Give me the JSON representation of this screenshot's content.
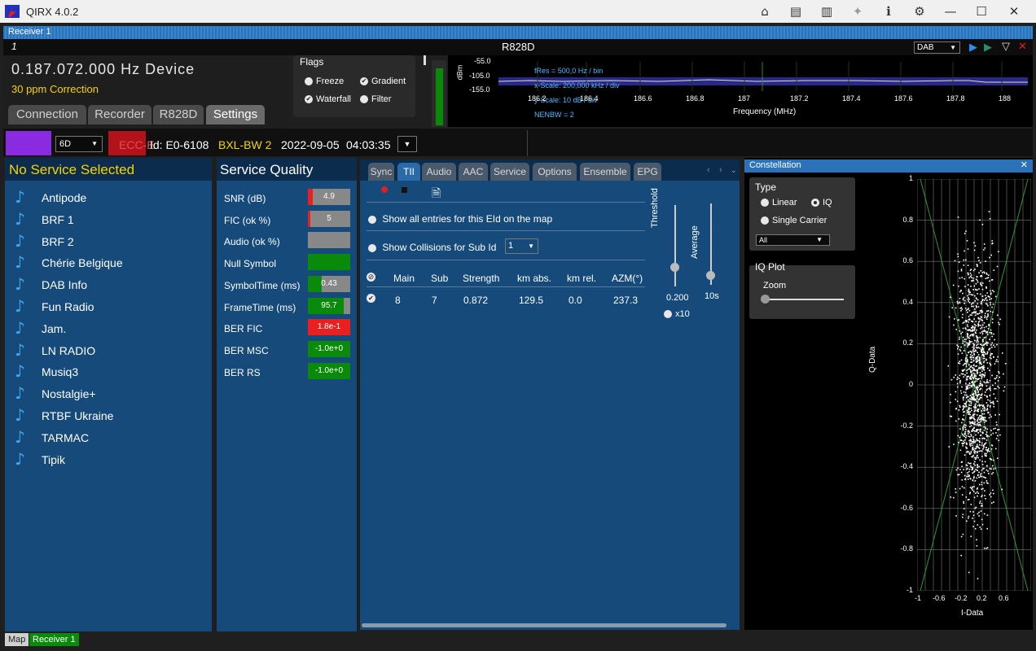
{
  "window": {
    "title": "QIRX 4.0.2"
  },
  "receiver": {
    "strip_title": "Receiver 1",
    "index": "1",
    "tuner": "R828D",
    "mode": "DAB"
  },
  "frequency": {
    "value": "0.187.072.000 Hz Device",
    "correction": "30 ppm Correction"
  },
  "tabs": [
    "Connection",
    "Recorder",
    "R828D",
    "Settings"
  ],
  "flags": {
    "title": "Flags",
    "freeze": "Freeze",
    "gradient": "Gradient",
    "waterfall": "Waterfall",
    "filter": "Filter"
  },
  "spectrum": {
    "y_unit": "dBm",
    "y_ticks": [
      "-55.0",
      "-105.0",
      "-155.0"
    ],
    "x_ticks": [
      "186.2",
      "186.4",
      "186.6",
      "186.8",
      "187",
      "187.2",
      "187.4",
      "187.6",
      "187.8",
      "188"
    ],
    "x_label": "Frequency (MHz)",
    "fres": "fRes = 500,0 Hz / bin",
    "xscale": "x-Scale: 200,000 kHz / div",
    "yscale": "y-Scale: 10 dB / div",
    "nenbw": "NENBW = 2"
  },
  "info": {
    "channel": "6D",
    "ecc_label": "ECC-E",
    "eid": "Id: E0-6108",
    "ensemble": "BXL-BW 2",
    "date": "2022-09-05",
    "time": "04:03:35"
  },
  "services": {
    "header": "No Service Selected",
    "items": [
      "Antipode",
      "BRF 1",
      "BRF 2",
      "Chérie Belgique",
      "DAB Info",
      "Fun Radio",
      "Jam.",
      "LN RADIO",
      "Musiq3",
      "Nostalgie+",
      "RTBF Ukraine",
      "TARMAC",
      "Tipik"
    ]
  },
  "quality": {
    "header": "Service Quality",
    "rows": [
      {
        "label": "SNR (dB)",
        "value": "4.9",
        "level": 0.12,
        "color": "#e82020"
      },
      {
        "label": "FIC (ok %)",
        "value": "5",
        "level": 0.05,
        "color": "#e82020"
      },
      {
        "label": "Audio (ok %)",
        "value": "",
        "level": 0,
        "color": "#e82020"
      },
      {
        "label": "Null Symbol",
        "value": "",
        "level": 1.0,
        "color": "#0a8a0a"
      },
      {
        "label": "SymbolTime (ms)",
        "value": "0.43",
        "level": 0.33,
        "color": "#0a8a0a"
      },
      {
        "label": "FrameTime (ms)",
        "value": "95.7",
        "level": 0.85,
        "color": "#0a8a0a"
      },
      {
        "label": "BER FIC",
        "value": "1.8e-1",
        "level": 1.0,
        "color": "#e82020"
      },
      {
        "label": "BER MSC",
        "value": "-1.0e+0",
        "level": 1.0,
        "color": "#0a8a0a"
      },
      {
        "label": "BER RS",
        "value": "-1.0e+0",
        "level": 1.0,
        "color": "#0a8a0a"
      }
    ]
  },
  "midtabs": [
    "Sync",
    "TII",
    "Audio",
    "AAC",
    "Service",
    "Options",
    "Ensemble",
    "EPG"
  ],
  "tii": {
    "show_all": "Show all entries for this EId on the map",
    "show_collisions": "Show Collisions for Sub Id",
    "sub_id": "1",
    "columns": [
      "Main",
      "Sub",
      "Strength",
      "km abs.",
      "km rel.",
      "AZM(°)"
    ],
    "rows": [
      [
        "8",
        "7",
        "0.872",
        "129.5",
        "0.0",
        "237.3"
      ]
    ],
    "threshold_label": "Threshold",
    "threshold_value": "0.200",
    "x10": "x10",
    "average_label": "Average",
    "average_value": "10s"
  },
  "constellation": {
    "title": "Constellation",
    "type_title": "Type",
    "linear": "Linear",
    "iq": "IQ",
    "single_carrier": "Single Carrier",
    "carrier_select": "All",
    "iqplot_title": "IQ Plot",
    "zoom": "Zoom",
    "y_label": "Q-Data",
    "x_label": "I-Data",
    "y_ticks": [
      "1",
      "0.8",
      "0.6",
      "0.4",
      "0.2",
      "0",
      "-0.2",
      "-0.4",
      "-0.6",
      "-0.8",
      "-1"
    ],
    "x_ticks": [
      "-1",
      "-0.6",
      "-0.2",
      "0.2",
      "0.6"
    ]
  },
  "bottom_tabs": [
    "Map",
    "Receiver 1"
  ]
}
